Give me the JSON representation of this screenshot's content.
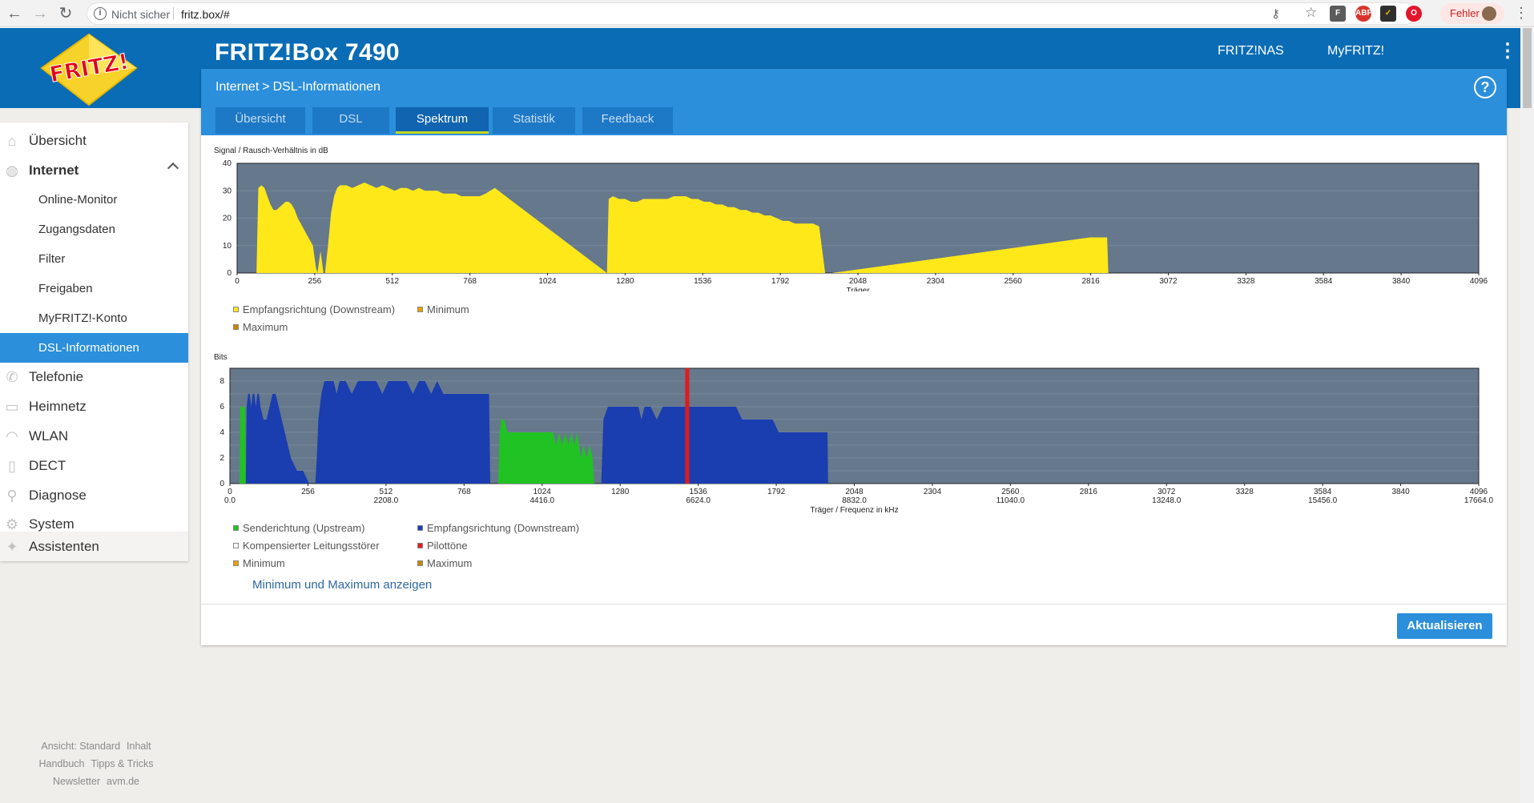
{
  "browser": {
    "back_icon": "back-arrow-icon",
    "forward_icon": "forward-arrow-icon",
    "reload_icon": "reload-icon",
    "security_label": "Nicht sicher",
    "url": "fritz.box/#",
    "error_badge": "Fehler"
  },
  "header": {
    "product_title": "FRITZ!Box 7490",
    "links": [
      "FRITZ!NAS",
      "MyFRITZ!"
    ],
    "logo_text": "FRITZ!"
  },
  "breadcrumb": {
    "parent": "Internet",
    "separator": ">",
    "current": "DSL-Informationen",
    "help": "?"
  },
  "tabs": [
    {
      "label": "Übersicht",
      "active": false
    },
    {
      "label": "DSL",
      "active": false
    },
    {
      "label": "Spektrum",
      "active": true
    },
    {
      "label": "Statistik",
      "active": false
    },
    {
      "label": "Feedback",
      "active": false
    }
  ],
  "sidebar": {
    "items": [
      {
        "label": "Übersicht",
        "icon": "home-icon"
      },
      {
        "label": "Internet",
        "icon": "globe-icon",
        "expanded": true
      },
      {
        "label": "Online-Monitor",
        "sub": true
      },
      {
        "label": "Zugangsdaten",
        "sub": true
      },
      {
        "label": "Filter",
        "sub": true
      },
      {
        "label": "Freigaben",
        "sub": true
      },
      {
        "label": "MyFRITZ!-Konto",
        "sub": true
      },
      {
        "label": "DSL-Informationen",
        "sub": true,
        "active": true
      },
      {
        "label": "Telefonie",
        "icon": "phone-icon"
      },
      {
        "label": "Heimnetz",
        "icon": "network-icon"
      },
      {
        "label": "WLAN",
        "icon": "wifi-icon"
      },
      {
        "label": "DECT",
        "icon": "dect-phone-icon"
      },
      {
        "label": "Diagnose",
        "icon": "diagnose-icon"
      },
      {
        "label": "System",
        "icon": "system-gear-icon"
      },
      {
        "label": "Assistenten",
        "icon": "wizard-icon"
      }
    ]
  },
  "footer": {
    "row1": [
      "Ansicht: Standard",
      "Inhalt"
    ],
    "row2": [
      "Handbuch",
      "Tipps & Tricks"
    ],
    "row3": [
      "Newsletter",
      "avm.de"
    ]
  },
  "colors": {
    "brand_blue": "#0a6cb5",
    "panel_blue": "#2b8fdb",
    "chart_bg": "#65788c",
    "downstream_yellow": "#ffe81a",
    "upstream_green": "#21c223",
    "downstream_blue": "#1a3db0",
    "pilot_red": "#e01b1b"
  },
  "legend_snr": [
    "Empfangsrichtung (Downstream)",
    "Minimum",
    "Maximum"
  ],
  "legend_bits": [
    "Senderichtung (Upstream)",
    "Empfangsrichtung (Downstream)",
    "Kompensierter Leitungsstörer",
    "Pilottöne",
    "Minimum",
    "Maximum"
  ],
  "minmax_link": "Minimum und Maximum anzeigen",
  "refresh_button": "Aktualisieren",
  "chart_data": [
    {
      "type": "area",
      "ylabel": "Signal / Rausch-Verhältnis in dB",
      "xlabel": "Träger",
      "xlim": [
        0,
        4096
      ],
      "ylim": [
        0,
        40
      ],
      "yticks": [
        0,
        10,
        20,
        30,
        40
      ],
      "xticks": [
        0,
        256,
        512,
        768,
        1024,
        1280,
        1536,
        1792,
        2048,
        2304,
        2560,
        2816,
        3072,
        3328,
        3584,
        3840,
        4096
      ],
      "grid": true,
      "legend_position": "bottom-left",
      "series": [
        {
          "name": "Empfangsrichtung (Downstream)",
          "color": "#ffe81a",
          "x": [
            64,
            70,
            80,
            90,
            100,
            110,
            120,
            130,
            140,
            150,
            160,
            170,
            180,
            190,
            200,
            210,
            220,
            230,
            240,
            250,
            255,
            260,
            265,
            270,
            275,
            280,
            285,
            290,
            300,
            310,
            320,
            330,
            340,
            350,
            360,
            380,
            400,
            420,
            440,
            460,
            480,
            500,
            520,
            540,
            560,
            580,
            600,
            620,
            640,
            660,
            680,
            700,
            720,
            740,
            760,
            780,
            800,
            820,
            850,
            1220,
            1226,
            1240,
            1260,
            1280,
            1300,
            1320,
            1340,
            1360,
            1380,
            1400,
            1420,
            1440,
            1460,
            1480,
            1500,
            1520,
            1540,
            1560,
            1580,
            1600,
            1620,
            1640,
            1660,
            1680,
            1700,
            1720,
            1740,
            1760,
            1780,
            1800,
            1820,
            1840,
            1860,
            1880,
            1900,
            1920,
            1940,
            1950,
            1960,
            1962,
            2814,
            2818,
            2830,
            2860,
            2870,
            2874
          ],
          "y": [
            0,
            31,
            32,
            31,
            28,
            25,
            23,
            23,
            24,
            25,
            26,
            26,
            25,
            23,
            20,
            18,
            16,
            14,
            12,
            10,
            6,
            2,
            0,
            4,
            8,
            4,
            0,
            0,
            10,
            22,
            28,
            31,
            32,
            32,
            32,
            31,
            32,
            33,
            32,
            31,
            32,
            31,
            30,
            31,
            31,
            30,
            31,
            30,
            30,
            30,
            29,
            29,
            29,
            28,
            28,
            28,
            28,
            29,
            31,
            0,
            27,
            28,
            27,
            27,
            26,
            26,
            27,
            27,
            27,
            27,
            27,
            28,
            28,
            28,
            27,
            27,
            26,
            26,
            25,
            25,
            24,
            24,
            23,
            23,
            22,
            22,
            21,
            21,
            20,
            19,
            19,
            18,
            18,
            18,
            18,
            17,
            0,
            0,
            0,
            0,
            13,
            13,
            13,
            13,
            13,
            0
          ]
        }
      ]
    },
    {
      "type": "area",
      "ylabel": "Bits",
      "xlabel": "Träger / Frequenz in kHz",
      "xlim": [
        0,
        4096
      ],
      "ylim": [
        0,
        9
      ],
      "yticks": [
        0,
        2,
        4,
        6,
        8
      ],
      "xticks": [
        0,
        256,
        512,
        768,
        1024,
        1280,
        1536,
        1792,
        2048,
        2304,
        2560,
        2816,
        3072,
        3328,
        3584,
        3840,
        4096
      ],
      "freq_ticks": [
        "0.0",
        "2208.0",
        "4416.0",
        "6624.0",
        "8832.0",
        "11040.0",
        "13248.0",
        "15456.0",
        "17664.0"
      ],
      "freq_tick_positions": [
        0,
        512,
        1024,
        1536,
        2048,
        2560,
        3072,
        3584,
        4096
      ],
      "grid": true,
      "legend_position": "bottom-left",
      "series": [
        {
          "name": "Senderichtung (Upstream)",
          "color": "#21c223",
          "segments": [
            {
              "x": [
                32,
                34,
                38,
                50,
                52
              ],
              "y": [
                0,
                6,
                6,
                6,
                0
              ]
            },
            {
              "x": [
                880,
                885,
                890,
                900,
                910,
                920,
                940,
                960,
                980,
                1000,
                1020,
                1040,
                1060,
                1070,
                1080,
                1090,
                1100,
                1110,
                1120,
                1130,
                1140,
                1150,
                1160,
                1170,
                1180,
                1190,
                1195
              ],
              "y": [
                0,
                4,
                5,
                5,
                4,
                4,
                4,
                4,
                4,
                4,
                4,
                4,
                4,
                3,
                4,
                3,
                4,
                3,
                4,
                3,
                4,
                2,
                3,
                2,
                3,
                2,
                0
              ]
            }
          ]
        },
        {
          "name": "Empfangsrichtung (Downstream)",
          "color": "#1a3db0",
          "segments": [
            {
              "x": [
                52,
                55,
                60,
                65,
                70,
                75,
                80,
                85,
                90,
                95,
                100,
                110,
                120,
                130,
                140,
                150,
                160,
                170,
                180,
                190,
                200,
                220,
                240,
                260,
                270,
                280,
                285,
                290,
                300,
                310,
                320,
                330,
                340,
                350,
                360,
                380,
                400,
                420,
                440,
                460,
                480,
                500,
                520,
                540,
                560,
                580,
                600,
                620,
                640,
                660,
                680,
                700,
                720,
                740,
                760,
                780,
                800,
                820,
                840,
                850,
                854
              ],
              "y": [
                0,
                6,
                7,
                7,
                6,
                7,
                7,
                6,
                7,
                7,
                6,
                5,
                5,
                6,
                7,
                7,
                6,
                5,
                4,
                3,
                2,
                1,
                1,
                0,
                0,
                0,
                2,
                5,
                7,
                8,
                8,
                8,
                8,
                7,
                8,
                8,
                7,
                8,
                8,
                8,
                8,
                7,
                8,
                8,
                8,
                8,
                7,
                8,
                8,
                7,
                8,
                7,
                7,
                7,
                7,
                7,
                7,
                7,
                7,
                7,
                0
              ]
            },
            {
              "x": [
                1218,
                1225,
                1240,
                1260,
                1280,
                1300,
                1320,
                1340,
                1350,
                1360,
                1380,
                1400,
                1420,
                1440,
                1460,
                1480,
                1500,
                1520,
                1540,
                1560,
                1580,
                1600,
                1620,
                1640,
                1660,
                1680,
                1700,
                1720,
                1740,
                1760,
                1780,
                1800,
                1820,
                1840,
                1860,
                1880,
                1900,
                1920,
                1940,
                1960,
                1962
              ],
              "y": [
                0,
                5,
                6,
                6,
                6,
                6,
                6,
                6,
                5,
                6,
                6,
                5,
                6,
                6,
                6,
                6,
                6,
                6,
                6,
                6,
                6,
                6,
                6,
                6,
                6,
                5,
                5,
                5,
                5,
                5,
                5,
                4,
                4,
                4,
                4,
                4,
                4,
                4,
                4,
                4,
                0
              ]
            }
          ]
        },
        {
          "name": "Pilottöne",
          "color": "#e01b1b",
          "x": [
            1500
          ],
          "y": [
            9
          ]
        }
      ]
    }
  ]
}
